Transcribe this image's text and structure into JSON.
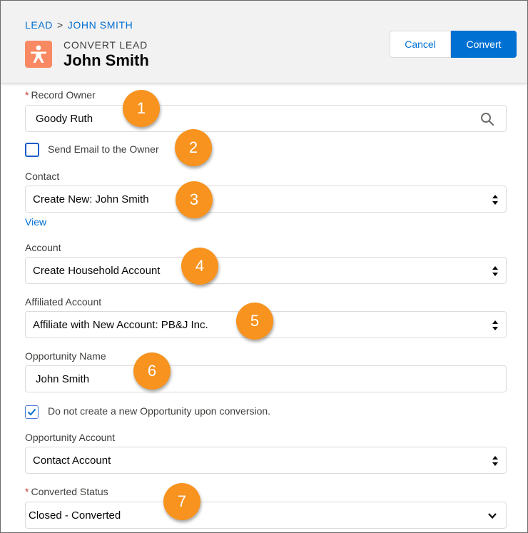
{
  "breadcrumb": {
    "parent": "LEAD",
    "separator": ">",
    "current": "JOHN SMITH"
  },
  "header": {
    "eyebrow": "CONVERT LEAD",
    "title": "John Smith",
    "icon": "lead-person-icon",
    "icon_color": "#f88962"
  },
  "actions": {
    "cancel_label": "Cancel",
    "convert_label": "Convert",
    "brand_color": "#0070d2"
  },
  "form": {
    "record_owner": {
      "required_marker": "*",
      "label": "Record Owner",
      "value": "Goody Ruth"
    },
    "send_email": {
      "label": "Send Email to the Owner",
      "checked": false
    },
    "contact": {
      "label": "Contact",
      "value": "Create New: John Smith",
      "view_link": "View"
    },
    "account": {
      "label": "Account",
      "value": "Create Household Account"
    },
    "affiliated_account": {
      "label": "Affiliated Account",
      "value": "Affiliate with New Account: PB&J Inc."
    },
    "opportunity_name": {
      "label": "Opportunity Name",
      "value": "John Smith"
    },
    "no_opportunity": {
      "label": "Do not create a new Opportunity upon conversion.",
      "checked": true
    },
    "opportunity_account": {
      "label": "Opportunity Account",
      "value": "Contact Account"
    },
    "converted_status": {
      "required_marker": "*",
      "label": "Converted Status",
      "value": "Closed - Converted"
    }
  },
  "callouts": [
    "1",
    "2",
    "3",
    "4",
    "5",
    "6",
    "7"
  ],
  "callout_color": "#f7931e"
}
